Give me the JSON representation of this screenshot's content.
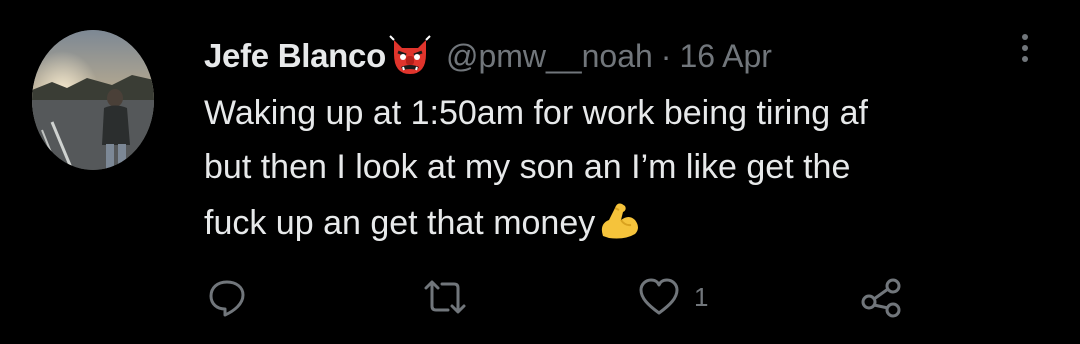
{
  "tweet": {
    "display_name": "Jefe Blanco",
    "name_badge_icon": "goblin-mask-emoji",
    "handle": "@pmw__noah",
    "separator": "·",
    "date": "16 Apr",
    "text_lines": [
      "Waking up at 1:50am for work being tiring af",
      "but then I look at my son an I’m like get the",
      "fuck up an get that money"
    ],
    "text_emoji": "flexed-biceps-emoji",
    "actions": {
      "reply_icon": "reply-icon",
      "retweet_icon": "retweet-icon",
      "like_icon": "heart-icon",
      "like_count": "1",
      "share_icon": "share-icon"
    }
  },
  "colors": {
    "background": "#000000",
    "text_primary": "#e7e9ea",
    "text_secondary": "#71767b",
    "goblin_red": "#e0342c",
    "flex_yellow": "#f5c33b"
  }
}
